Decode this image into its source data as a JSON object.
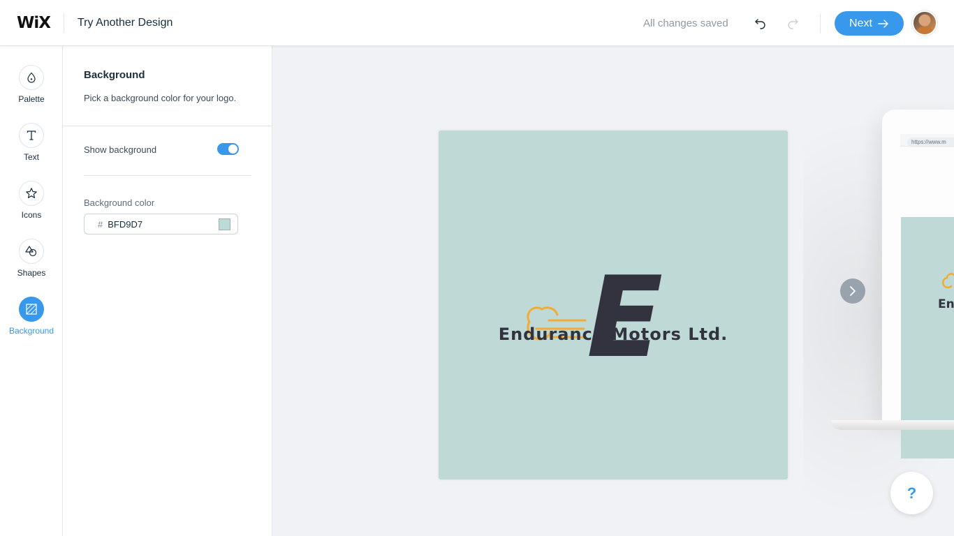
{
  "header": {
    "brand": "WiX",
    "title": "Try Another Design",
    "save_status": "All changes saved",
    "next_label": "Next"
  },
  "sidebar": {
    "items": [
      {
        "label": "Palette",
        "icon": "palette-icon"
      },
      {
        "label": "Text",
        "icon": "text-icon"
      },
      {
        "label": "Icons",
        "icon": "star-icon"
      },
      {
        "label": "Shapes",
        "icon": "shapes-icon"
      },
      {
        "label": "Background",
        "icon": "background-icon",
        "active": true
      }
    ]
  },
  "panel": {
    "title": "Background",
    "description": "Pick a background color for your logo.",
    "show_background_label": "Show background",
    "show_background": true,
    "color_label": "Background color",
    "color_prefix": "#",
    "color_value": "BFD9D7",
    "swatch_color": "#BFD9D7"
  },
  "canvas": {
    "background_color": "#BFD9D7",
    "logo_letter": "E",
    "company_name": "Endurance Motors Ltd.",
    "letter_color": "#32333F",
    "accent_color": "#F2AC33",
    "mockup_url": "https://www.m",
    "mockup_text": "En"
  },
  "help": {
    "label": "?"
  },
  "colors": {
    "accent": "#3899EC"
  }
}
